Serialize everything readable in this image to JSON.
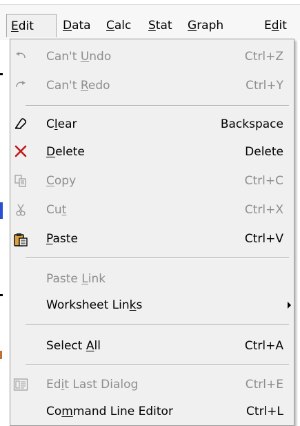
{
  "menubar": {
    "items": [
      {
        "label": "Edit",
        "accel_index": 0
      },
      {
        "label": "Data",
        "accel_index": 0
      },
      {
        "label": "Calc",
        "accel_index": 0
      },
      {
        "label": "Stat",
        "accel_index": 0
      },
      {
        "label": "Graph",
        "accel_index": 0
      },
      {
        "label": "Edit",
        "accel_index": 1
      }
    ]
  },
  "edit_menu": {
    "items": [
      {
        "label": "Can't Undo",
        "shortcut": "Ctrl+Z",
        "enabled": false,
        "icon": "undo-icon"
      },
      {
        "label": "Can't Redo",
        "shortcut": "Ctrl+Y",
        "enabled": false,
        "icon": "redo-icon"
      },
      {
        "label": "Clear",
        "shortcut": "Backspace",
        "enabled": true,
        "icon": "eraser-icon"
      },
      {
        "label": "Delete",
        "shortcut": "Delete",
        "enabled": true,
        "icon": "delete-x-icon"
      },
      {
        "label": "Copy",
        "shortcut": "Ctrl+C",
        "enabled": false,
        "icon": "copy-icon"
      },
      {
        "label": "Cut",
        "shortcut": "Ctrl+X",
        "enabled": false,
        "icon": "scissors-icon"
      },
      {
        "label": "Paste",
        "shortcut": "Ctrl+V",
        "enabled": true,
        "icon": "clipboard-icon"
      },
      {
        "label": "Paste Link",
        "shortcut": "",
        "enabled": false,
        "icon": ""
      },
      {
        "label": "Worksheet Links",
        "shortcut": "",
        "enabled": true,
        "icon": "",
        "submenu": true
      },
      {
        "label": "Select All",
        "shortcut": "Ctrl+A",
        "enabled": true,
        "icon": ""
      },
      {
        "label": "Edit Last Dialog",
        "shortcut": "Ctrl+E",
        "enabled": false,
        "icon": "dialog-icon"
      },
      {
        "label": "Command Line Editor",
        "shortcut": "Ctrl+L",
        "enabled": true,
        "icon": ""
      }
    ]
  },
  "colors": {
    "menu_background": "#f0f0f0",
    "disabled_text": "#8d8d8d",
    "delete_icon": "#c01818",
    "clipboard_icon": "#d9a23a"
  }
}
